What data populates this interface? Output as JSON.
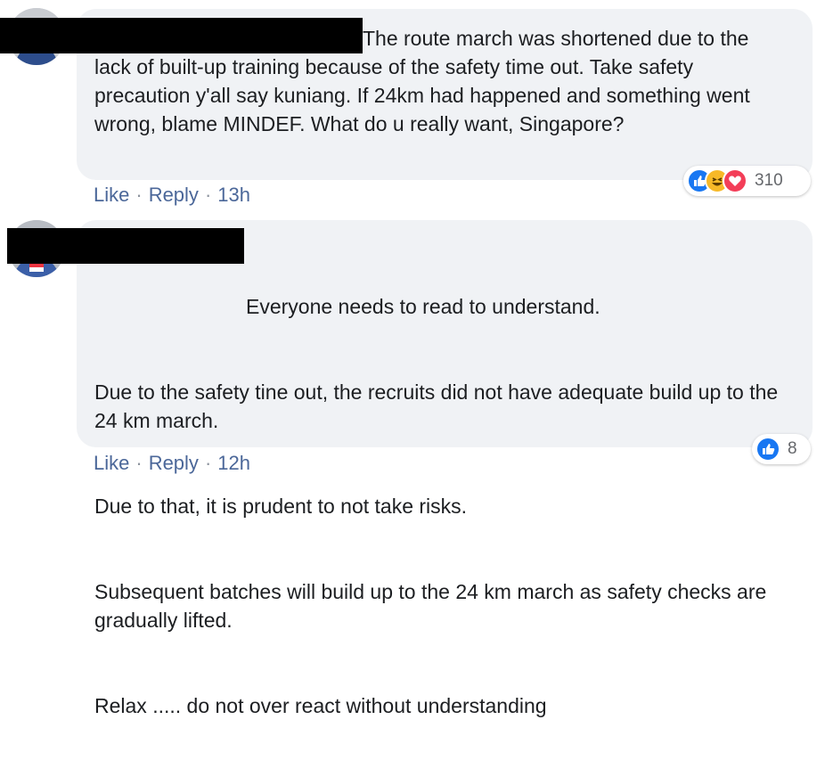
{
  "comments": [
    {
      "text": "The route march was shortened due to the lack of built-up training because of the safety time out. Take safety precaution y'all say kuniang. If 24km had happened and something went wrong, blame MINDEF. What do u really want, Singapore?",
      "actions": {
        "like": "Like",
        "separator": "·",
        "reply": "Reply",
        "time": "13h"
      },
      "reactions": {
        "icons": [
          "like-icon",
          "haha-icon",
          "love-icon"
        ],
        "count": "310"
      }
    },
    {
      "lines": [
        "Everyone needs to read to understand.",
        "Due to the safety tine out, the recruits did not have adequate build up to the 24 km march.",
        "Due to that, it is prudent to not take risks.",
        "Subsequent batches will build up to the 24 km march as safety checks are gradually lifted.",
        "Relax ..... do not over react without understanding"
      ],
      "actions": {
        "like": "Like",
        "separator": "·",
        "reply": "Reply",
        "time": "12h"
      },
      "reactions": {
        "icons": [
          "like-icon"
        ],
        "count": "8"
      }
    }
  ],
  "colors": {
    "bubble": "#f0f2f5",
    "link": "#4b6799",
    "like_blue": "#1877f2",
    "haha_yellow": "#f7b928",
    "love_red": "#f33e58",
    "redaction": "#000000"
  }
}
